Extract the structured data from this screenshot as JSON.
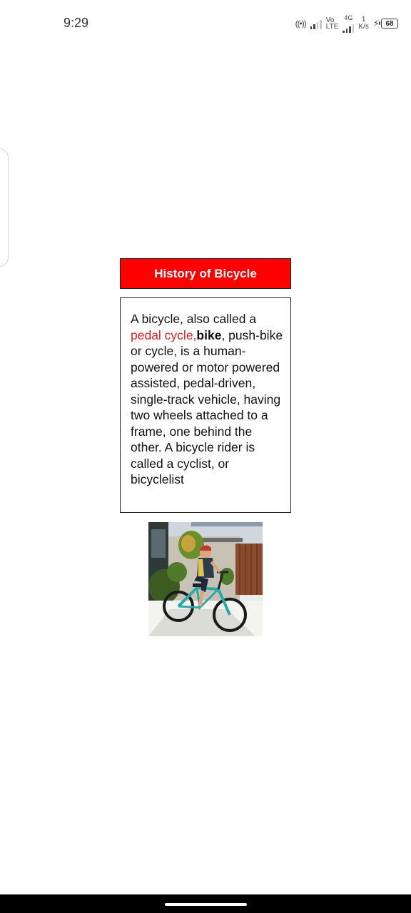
{
  "status_bar": {
    "time": "9:29",
    "net_top": "Vo",
    "net_bottom": "LTE",
    "net_gen": "4G",
    "speed_value": "1",
    "speed_unit": "K/s",
    "battery_level": "68"
  },
  "article": {
    "title": "History of Bicycle",
    "text_intro": "A bicycle, also called a ",
    "highlight_text": "pedal cycle,",
    "bold_text": "bike",
    "text_rest": ", push-bike or cycle, is a human-powered or motor powered assisted, pedal-driven, single-track vehicle, having two wheels attached to a frame, one behind the other. A bicycle rider is called a cyclist, or bicyclelist"
  },
  "colors": {
    "title_background": "#ff0000",
    "highlight": "#e32222"
  }
}
